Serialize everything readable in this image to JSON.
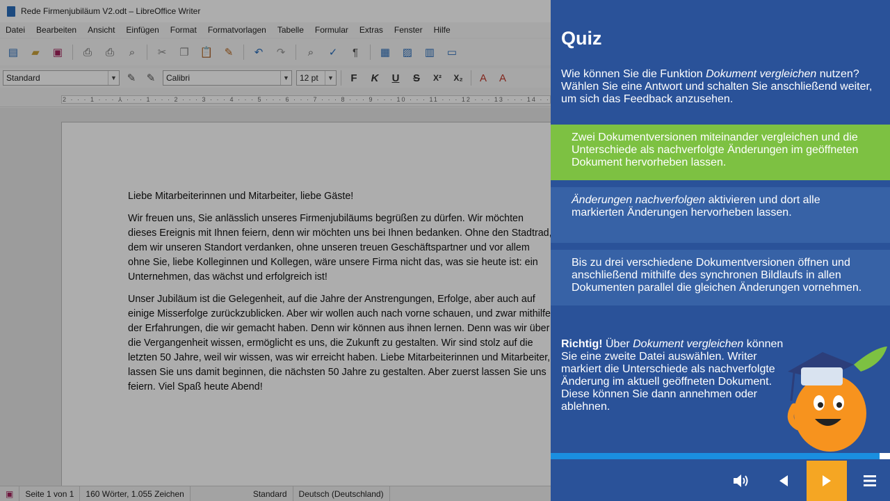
{
  "window": {
    "title": "Rede Firmenjubiläum V2.odt – LibreOffice Writer"
  },
  "menu": [
    "Datei",
    "Bearbeiten",
    "Ansicht",
    "Einfügen",
    "Format",
    "Formatvorlagen",
    "Tabelle",
    "Formular",
    "Extras",
    "Fenster",
    "Hilfe"
  ],
  "formatting": {
    "style": "Standard",
    "font": "Calibri",
    "size": "12 pt",
    "bold": "F",
    "italic": "K",
    "underline": "U",
    "strike": "S",
    "superscript": "X²",
    "subscript": "X₂"
  },
  "ruler": {
    "ticks": "2 · · · 1 · · · ⅄ · · · 1 · · · 2 · · · 3 · · · 4 · · · 5 · · · 6 · · · 7 · · · 8 · · · 9 · · · 10 · · · 11 · · · 12 · · · 13 · · · 14 · · · 15"
  },
  "document": {
    "paragraphs": [
      "Liebe Mitarbeiterinnen und Mitarbeiter, liebe Gäste!",
      "Wir freuen uns, Sie anlässlich unseres Firmenjubiläums begrüßen zu dürfen. Wir möchten dieses Ereignis mit Ihnen feiern, denn wir möchten uns bei Ihnen bedanken. Ohne den Stadtrad, dem wir unseren Standort verdanken, ohne unseren treuen Geschäftspartner und vor allem ohne Sie, liebe Kolleginnen und Kollegen, wäre unsere Firma nicht das, was sie heute ist: ein Unternehmen, das wächst und erfolgreich ist!",
      "Unser Jubiläum ist die Gelegenheit, auf die Jahre der Anstrengungen, Erfolge, aber auch auf einige Misserfolge zurückzublicken. Aber wir wollen auch nach vorne schauen, und zwar mithilfe der Erfahrungen, die wir gemacht haben. Denn wir können aus ihnen lernen. Denn was wir über die Vergangenheit wissen, ermöglicht es uns, die Zukunft zu gestalten. Wir sind stolz auf die letzten 50 Jahre, weil wir wissen, was wir erreicht haben. Liebe Mitarbeiterinnen und Mitarbeiter, lassen Sie uns damit beginnen, die nächsten 50 Jahre zu gestalten. Aber zuerst lassen Sie uns feiern. Viel Spaß heute Abend!"
    ]
  },
  "status": {
    "page": "Seite 1 von 1",
    "words": "160 Wörter, 1.055 Zeichen",
    "style": "Standard",
    "language": "Deutsch (Deutschland)"
  },
  "quiz": {
    "title": "Quiz",
    "question_pre": "Wie können Sie die Funktion ",
    "question_em": "Dokument vergleichen",
    "question_post": " nutzen? Wählen Sie eine Antwort und schalten Sie anschließend weiter, um sich das Feedback anzusehen.",
    "answer1": "Zwei Dokumentversionen miteinander vergleichen und die Unterschiede als nachverfolgte Änderungen im geöffneten Dokument hervorheben lassen.",
    "answer2_em": "Änderungen nachverfolgen",
    "answer2_rest": " aktivieren und dort alle markierten Änderungen hervorheben lassen.",
    "answer3": "Bis zu drei verschiedene Dokumentversionen öffnen und anschließend mithilfe des synchronen Bildlaufs in allen Dokumenten parallel die gleichen Änderungen vornehmen.",
    "feedback_strong": "Richtig!",
    "feedback_pre": " Über ",
    "feedback_em": "Dokument vergleichen",
    "feedback_post": " können Sie eine zweite Datei auswählen. Writer markiert die Unterschiede als nachverfolgte Änderung im aktuell geöffneten Dokument. Diese können Sie dann annehmen oder ablehnen.",
    "progress": 0.97,
    "colors": {
      "panel": "#2a5299",
      "correct": "#7dc142",
      "option": "#3762a6",
      "next": "#f5a623",
      "progress": "#1a8fe0"
    }
  }
}
